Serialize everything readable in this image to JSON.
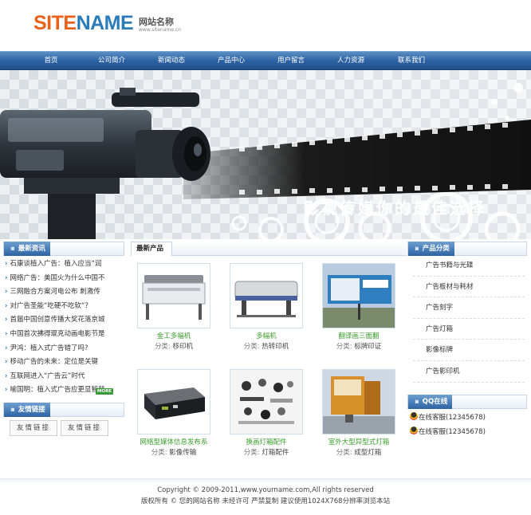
{
  "header": {
    "logo_part1": "SITE",
    "logo_part2": "NAME",
    "logo_cn": "网站名称",
    "logo_url": "www.sitename.cn"
  },
  "nav": [
    "首页",
    "公司简介",
    "新闻动态",
    "产品中心",
    "用户留言",
    "人力资源",
    "联系我们"
  ],
  "banner": {
    "slogan": "影视传媒你的最佳选择"
  },
  "news": {
    "title": "最新资讯",
    "items": [
      "石康谈植入广告：植入应当“润",
      "网络广告：美国火为什么中国不",
      "三网融合方案河电公布 刺激传",
      "对广告圣能“吃硬不吃软”？",
      "首届中国创意传播大奖花落京城",
      "中国首次拂得琨克动画电影节是",
      "尹鸿：植入式广告错了吗?",
      "移动广告的未来：定位是关键",
      "互联网进入“广告云”时代",
      "喻国明：植入式广告应更显智慧"
    ],
    "more": "MORE"
  },
  "friends": {
    "title": "友情链接",
    "buttons": [
      "友情链接",
      "友情链接"
    ]
  },
  "products": {
    "title": "最新产品",
    "category_label": "分类:",
    "items": [
      {
        "name": "金工多幅机",
        "category": "移印机"
      },
      {
        "name": "多幅机",
        "category": "热转印机"
      },
      {
        "name": "翻译画三面翻",
        "category": "标牌印证"
      },
      {
        "name": "网络型媒体信息发布系",
        "category": "影像传输"
      },
      {
        "name": "换画灯箱配件",
        "category": "灯箱配件"
      },
      {
        "name": "室外大型异型式灯箱",
        "category": "成型灯箱"
      }
    ]
  },
  "categories": {
    "title": "产品分类",
    "items": [
      "广告书籍与光碟",
      "广告板材与耗材",
      "广告刻字",
      "广告灯箱",
      "影像标牌",
      "广告影印机"
    ]
  },
  "qq": {
    "title": "QQ在线",
    "items": [
      "在线客服(12345678)",
      "在线客服(12345678)"
    ]
  },
  "footer": {
    "copyright": "Copyright © 2009-2011,www.yourname.com,All rights reserved",
    "notice": "版权所有 © 您的网站名称 未经许可 严禁复制 建议使用1024X768分辨率浏览本站"
  }
}
